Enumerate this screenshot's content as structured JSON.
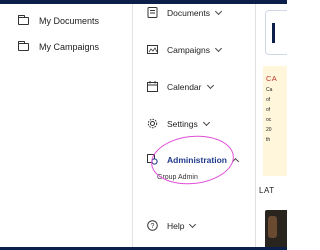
{
  "left_panel": {
    "items": [
      {
        "label": "My Documents"
      },
      {
        "label": "My Campaigns"
      }
    ]
  },
  "nav": {
    "items": [
      {
        "label": "Documents",
        "icon": "documents-icon"
      },
      {
        "label": "Campaigns",
        "icon": "campaigns-icon"
      },
      {
        "label": "Calendar",
        "icon": "calendar-icon"
      },
      {
        "label": "Settings",
        "icon": "settings-gear-icon"
      },
      {
        "label": "Administration",
        "icon": "admin-icon"
      },
      {
        "label": "Help",
        "icon": "help-icon"
      }
    ],
    "sub_item": "Group Admin"
  },
  "right": {
    "notice_heading": "CA",
    "notice_lines": [
      "Ca",
      "of",
      "of",
      "oc",
      "20",
      "th"
    ],
    "section_title": "LAT"
  },
  "colors": {
    "header_bar": "#0b1f4a",
    "highlight_circle": "#e050d8",
    "notice_bg": "#fff6dc"
  }
}
